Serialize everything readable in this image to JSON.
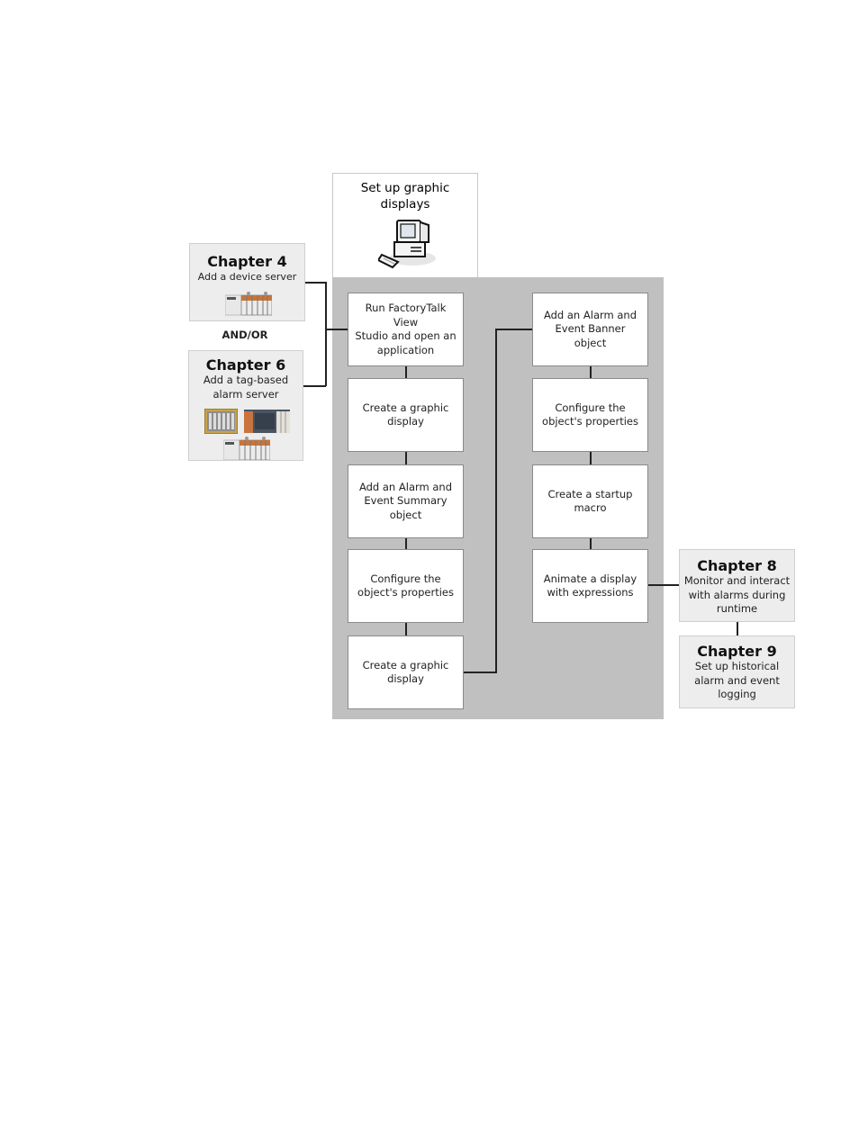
{
  "header": {
    "title_line1": "Set up graphic",
    "title_line2": "displays",
    "icon": "computer-icon"
  },
  "prerequisites": {
    "chapter4": {
      "title": "Chapter 4",
      "description": "Add a device server",
      "icon": "plc-controller-icon"
    },
    "connector_text": "AND/OR",
    "chapter6": {
      "title": "Chapter 6",
      "description_line1": "Add a tag-based",
      "description_line2": "alarm server",
      "icons": [
        "plc-rack-icon",
        "plc-module-icon",
        "plc-controller-icon"
      ]
    }
  },
  "steps_left": [
    {
      "line1": "Run FactoryTalk View",
      "line2": "Studio and open an",
      "line3": "application"
    },
    {
      "line1": "Create a graphic",
      "line2": "display"
    },
    {
      "line1": "Add an Alarm and",
      "line2": "Event Summary",
      "line3": "object"
    },
    {
      "line1": "Configure the",
      "line2": "object's  properties"
    },
    {
      "line1": "Create a graphic",
      "line2": "display"
    }
  ],
  "steps_right": [
    {
      "line1": "Add an Alarm and",
      "line2": "Event Banner",
      "line3": "object"
    },
    {
      "line1": "Configure the",
      "line2": "object's  properties"
    },
    {
      "line1": "Create a startup",
      "line2": "macro"
    },
    {
      "line1": "Animate a display",
      "line2": "with expressions"
    }
  ],
  "next_chapters": {
    "chapter8": {
      "title": "Chapter 8",
      "line1": "Monitor and interact",
      "line2": "with alarms during",
      "line3": "runtime"
    },
    "chapter9": {
      "title": "Chapter 9",
      "line1": "Set up historical",
      "line2": "alarm and event",
      "line3": "logging"
    }
  },
  "colors": {
    "panel": "#c0c0c0",
    "chapter_box": "#ededed",
    "step_box": "#ffffff",
    "connector": "#222222"
  }
}
